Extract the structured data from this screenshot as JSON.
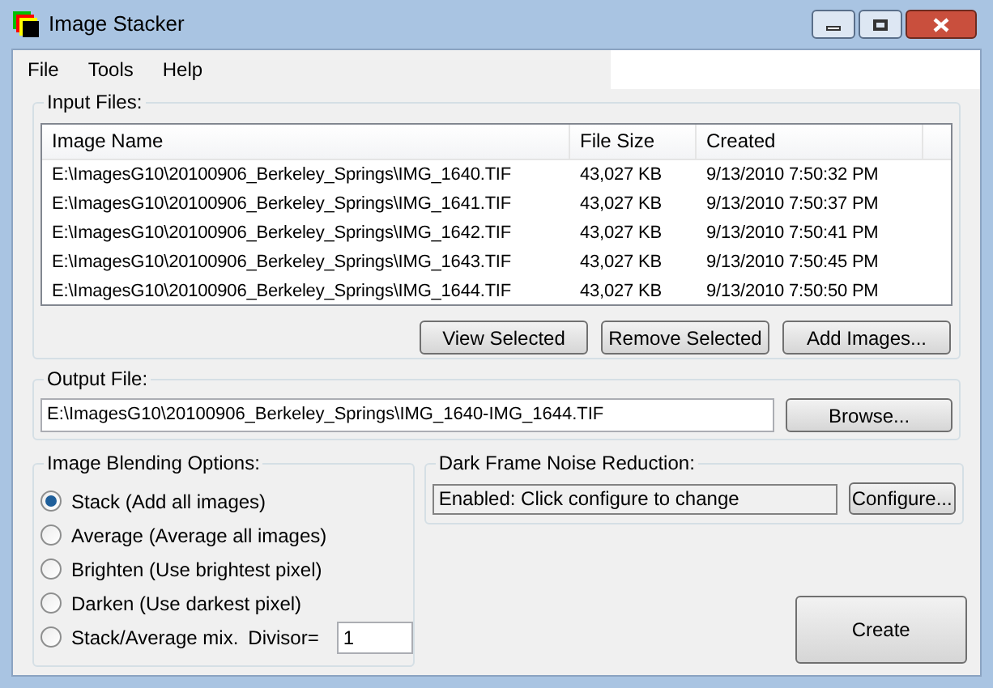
{
  "window": {
    "title": "Image Stacker"
  },
  "menu": [
    "File",
    "Tools",
    "Help"
  ],
  "input_files": {
    "title": "Input Files:",
    "columns": [
      "Image Name",
      "File Size",
      "Created"
    ],
    "rows": [
      [
        "E:\\ImagesG10\\20100906_Berkeley_Springs\\IMG_1640.TIF",
        "43,027 KB",
        "9/13/2010 7:50:32 PM"
      ],
      [
        "E:\\ImagesG10\\20100906_Berkeley_Springs\\IMG_1641.TIF",
        "43,027 KB",
        "9/13/2010 7:50:37 PM"
      ],
      [
        "E:\\ImagesG10\\20100906_Berkeley_Springs\\IMG_1642.TIF",
        "43,027 KB",
        "9/13/2010 7:50:41 PM"
      ],
      [
        "E:\\ImagesG10\\20100906_Berkeley_Springs\\IMG_1643.TIF",
        "43,027 KB",
        "9/13/2010 7:50:45 PM"
      ],
      [
        "E:\\ImagesG10\\20100906_Berkeley_Springs\\IMG_1644.TIF",
        "43,027 KB",
        "9/13/2010 7:50:50 PM"
      ]
    ],
    "buttons": [
      "View Selected",
      "Remove Selected",
      "Add Images..."
    ]
  },
  "output_file": {
    "title": "Output File:",
    "value": "E:\\ImagesG10\\20100906_Berkeley_Springs\\IMG_1640-IMG_1644.TIF",
    "button": "Browse..."
  },
  "blending": {
    "title": "Image Blending Options:",
    "options": [
      {
        "label": "Stack (Add all images)",
        "selected": true
      },
      {
        "label": "Average (Average all images)",
        "selected": false
      },
      {
        "label": "Brighten (Use brightest pixel)",
        "selected": false
      },
      {
        "label": "Darken (Use darkest pixel)",
        "selected": false
      },
      {
        "label": "Stack/Average mix.",
        "selected": false
      }
    ],
    "divisor": {
      "label": "Divisor=",
      "value": "1"
    }
  },
  "dark_frame": {
    "title": "Dark Frame Noise Reduction:",
    "status": "Enabled: Click configure to change",
    "button": "Configure..."
  },
  "create_button": "Create"
}
